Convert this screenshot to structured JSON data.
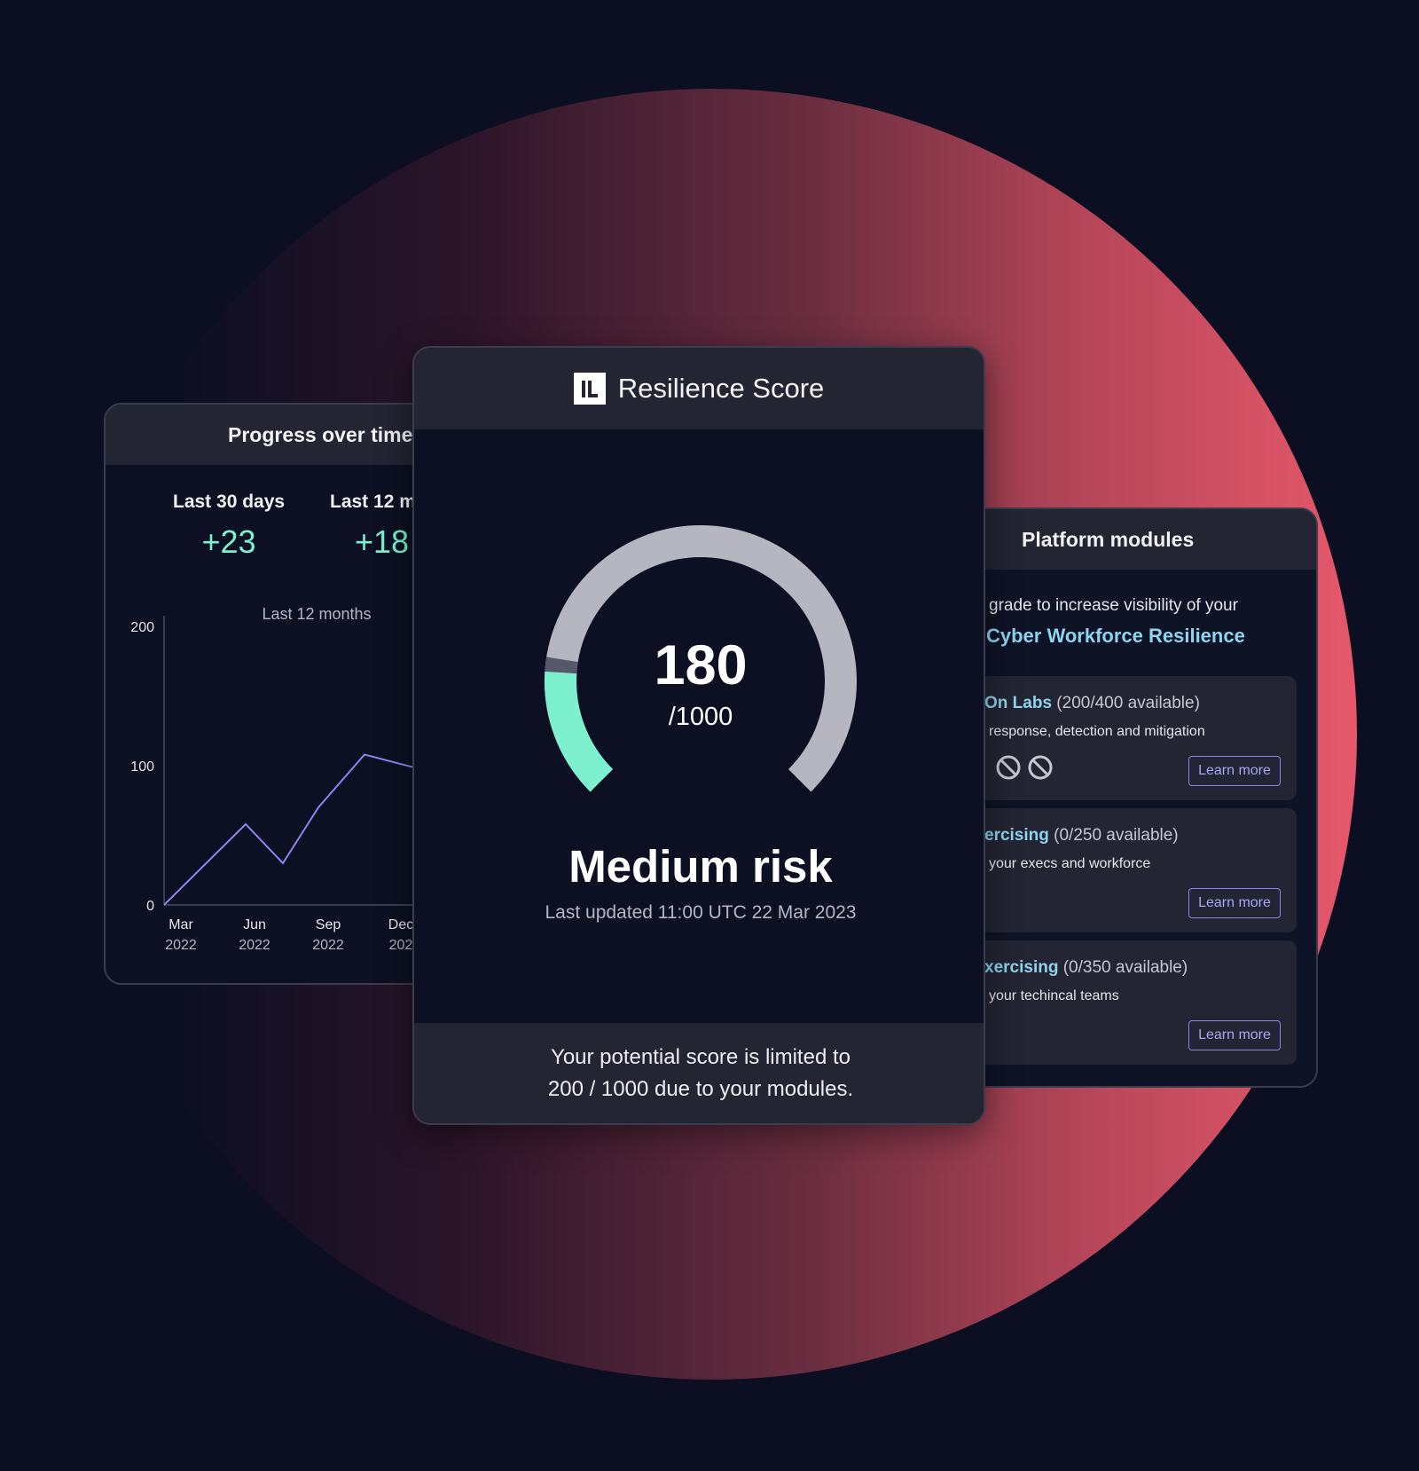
{
  "progress": {
    "title": "Progress over time",
    "stats": [
      {
        "label": "Last 30 days",
        "value": "+23"
      },
      {
        "label": "Last 12 m",
        "value": "+18"
      }
    ],
    "chart_label": "Last 12 months"
  },
  "chart_data": {
    "type": "line",
    "title": "Last 12 months",
    "x": [
      "Mar 2022",
      "May 2022",
      "Jun 2022",
      "Aug 2022",
      "Sep 2022",
      "Dec 2022"
    ],
    "values": [
      0,
      58,
      30,
      70,
      108,
      98
    ],
    "ylim": [
      0,
      200
    ],
    "y_ticks": [
      "200",
      "100",
      "0"
    ],
    "x_ticks": [
      {
        "month": "Mar",
        "year": "2022"
      },
      {
        "month": "Jun",
        "year": "2022"
      },
      {
        "month": "Sep",
        "year": "2022"
      },
      {
        "month": "Dec",
        "year": "202"
      }
    ],
    "line_color": "#8b86f0"
  },
  "main": {
    "title": "Resilience Score",
    "logo_text": "IL",
    "score": "180",
    "score_max": "/1000",
    "score_fraction": 0.18,
    "risk": "Medium risk",
    "updated": "Last updated 11:00 UTC 22 Mar 2023",
    "footer_line1": "Your potential score is limited to",
    "footer_line2": "200 / 1000 due to your modules."
  },
  "modules": {
    "title": "Platform modules",
    "promo": "grade to increase visibility of your",
    "promo_link": "Cyber Workforce Resilience",
    "items": [
      {
        "name": "On Labs",
        "availability": "(200/400 available)",
        "desc": "response, detection and mitigation",
        "button": "Learn more"
      },
      {
        "name": "ercising",
        "availability": "(0/250 available)",
        "desc": "your execs and workforce",
        "button": "Learn more"
      },
      {
        "name": "xercising",
        "availability": "(0/350 available)",
        "desc": "your techincal teams",
        "button": "Learn more"
      }
    ]
  },
  "colors": {
    "accent_green": "#7df0cd",
    "line_purple": "#8b86f0",
    "gauge_grey": "#b5b6c0",
    "link_blue": "#8fd3ee"
  }
}
